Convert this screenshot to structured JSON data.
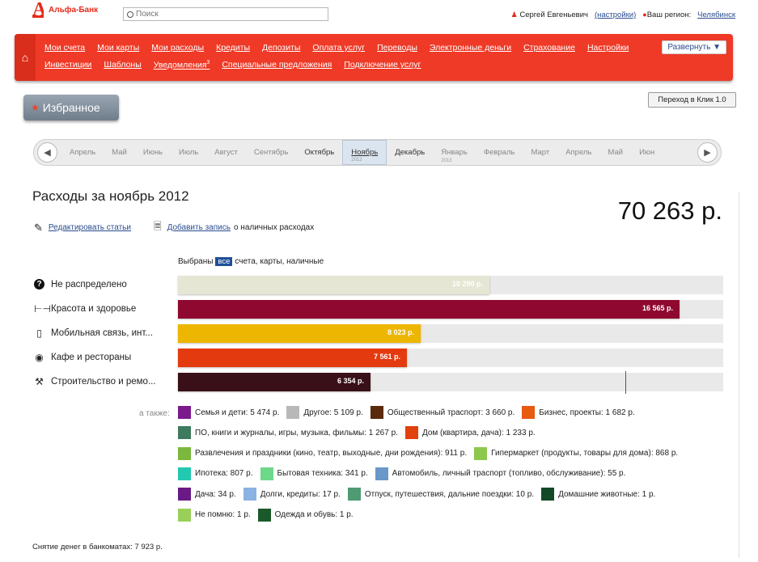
{
  "bank": {
    "logo_mark": "А",
    "name": "Альфа-Банк"
  },
  "search": {
    "placeholder": "Поиск"
  },
  "user": {
    "name": "Сергей Евгеньевич",
    "settings_link": "(настройки)",
    "region_label": "Ваш регион:",
    "region_value": "Челябинск"
  },
  "nav": {
    "row1": [
      "Мои счета",
      "Мои карты",
      "Мои расходы",
      "Кредиты",
      "Депозиты",
      "Оплата услуг",
      "Переводы",
      "Электронные деньги",
      "Страхование",
      "Настройки"
    ],
    "row2": [
      "Инвестиции",
      "Шаблоны",
      "Уведомления",
      "Специальные предложения",
      "Подключение услуг"
    ],
    "notifications_count": "3",
    "expand_label": "Развернуть ▼"
  },
  "favorites": {
    "label": "Избранное"
  },
  "klik_button": "Переход в Клик 1.0",
  "months": [
    {
      "label": "Апрель",
      "style": "light"
    },
    {
      "label": "Май",
      "style": "light"
    },
    {
      "label": "Июнь",
      "style": "light"
    },
    {
      "label": "Июль",
      "style": "light"
    },
    {
      "label": "Август",
      "style": "light"
    },
    {
      "label": "Сентябрь",
      "style": "light"
    },
    {
      "label": "Октябрь",
      "style": "dark"
    },
    {
      "label": "Ноябрь",
      "style": "selected",
      "year": "2012"
    },
    {
      "label": "Декабрь",
      "style": "dark"
    },
    {
      "label": "Январь",
      "style": "light",
      "year": "2013"
    },
    {
      "label": "Февраль",
      "style": "light"
    },
    {
      "label": "Март",
      "style": "light"
    },
    {
      "label": "Апрель",
      "style": "light"
    },
    {
      "label": "Май",
      "style": "light"
    },
    {
      "label": "Июн",
      "style": "light"
    }
  ],
  "page": {
    "title": "Расходы за ноябрь 2012",
    "total": "70 263 р.",
    "edit_link": "Редактировать статьи",
    "add_link": "Добавить запись",
    "add_suffix": "о наличных расходах"
  },
  "filter": {
    "prefix": "Выбраны",
    "badge": "все",
    "suffix": "счета, карты, наличные"
  },
  "categories": [
    {
      "label": "Не распределено",
      "icon": "question-icon",
      "value": 10290,
      "value_text": "10 290 р.",
      "color": "#e6e6d4"
    },
    {
      "label": "Красота и здоровье",
      "icon": "dumbbell-icon",
      "value": 16565,
      "value_text": "16 565 р.",
      "color": "#8f0830"
    },
    {
      "label": "Мобильная связь, инт...",
      "icon": "phone-icon",
      "value": 8023,
      "value_text": "8 023 р.",
      "color": "#edb600"
    },
    {
      "label": "Кафе и рестораны",
      "icon": "plate-icon",
      "value": 7561,
      "value_text": "7 561 р.",
      "color": "#e43a10"
    },
    {
      "label": "Строительство и ремо...",
      "icon": "tools-icon",
      "value": 6354,
      "value_text": "6 354 р.",
      "color": "#3a1018"
    }
  ],
  "chart_data": {
    "type": "bar",
    "categories": [
      "Не распределено",
      "Красота и здоровье",
      "Мобильная связь, инт...",
      "Кафе и рестораны",
      "Строительство и ремо..."
    ],
    "values": [
      10290,
      16565,
      8023,
      7561,
      6354
    ],
    "title": "Расходы за ноябрь 2012"
  },
  "also_label": "а также:",
  "also": [
    [
      {
        "label": "Семья и дети: 5 474 р.",
        "color": "#7a1a8c"
      },
      {
        "label": "Другое: 5 109 р.",
        "color": "#b8b8b8"
      },
      {
        "label": "Общественный траспорт: 3 660 р.",
        "color": "#5a2a0a"
      },
      {
        "label": "Бизнес, проекты: 1 682 р.",
        "color": "#e85a10"
      }
    ],
    [
      {
        "label": "ПО, книги и журналы, игры, музыка, фильмы: 1 267 р.",
        "color": "#3e7a5e"
      },
      {
        "label": "Дом (квартира, дача): 1 233 р.",
        "color": "#e2400c"
      }
    ],
    [
      {
        "label": "Развлечения и праздники (кино, театр, выходные, дни рождения): 911 р.",
        "color": "#7ab83e"
      },
      {
        "label": "Гипермаркет (продукты, товары для дома): 868 р.",
        "color": "#8cc84e"
      }
    ],
    [
      {
        "label": "Ипотека: 807 р.",
        "color": "#22c8b0"
      },
      {
        "label": "Бытовая техника: 341 р.",
        "color": "#6ed88a"
      },
      {
        "label": "Автомобиль, личный траспорт (топливо, обслуживание): 55 р.",
        "color": "#6a98c8"
      }
    ],
    [
      {
        "label": "Дача: 34 р.",
        "color": "#6a1a86"
      },
      {
        "label": "Долги, кредиты: 17 р.",
        "color": "#8ab2e2"
      },
      {
        "label": "Отпуск, путешествия, дальние поездки: 10 р.",
        "color": "#4e9a72"
      },
      {
        "label": "Домашние животные: 1 р.",
        "color": "#124a28"
      }
    ],
    [
      {
        "label": "Не помню: 1 р.",
        "color": "#9ad05a"
      },
      {
        "label": "Одежда и обувь: 1 р.",
        "color": "#1a5a2a"
      }
    ]
  ],
  "cash_withdrawal": "Снятие денег в банкоматах: 7 923 р."
}
